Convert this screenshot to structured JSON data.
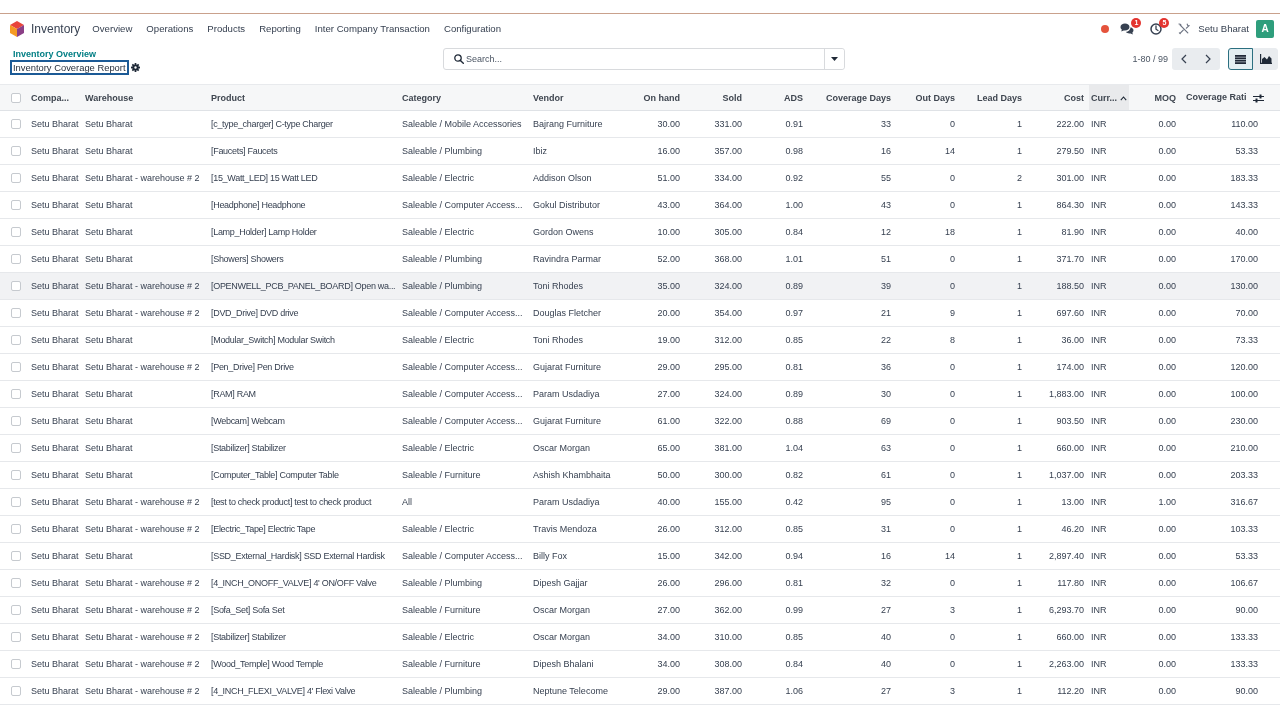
{
  "navbar": {
    "app_name": "Inventory",
    "menu": [
      "Overview",
      "Operations",
      "Products",
      "Reporting",
      "Inter Company Transaction",
      "Configuration"
    ],
    "notifications": [
      {
        "kind": "messages",
        "count": "1"
      },
      {
        "kind": "activities",
        "count": "5"
      }
    ],
    "user_name": "Setu Bharat",
    "avatar_letter": "A"
  },
  "breadcrumbs": [
    {
      "label": "Inventory Overview",
      "current": false,
      "focused": false
    },
    {
      "label": "Inventory Coverage Report",
      "current": true,
      "focused": true
    }
  ],
  "search": {
    "placeholder": "Search..."
  },
  "pager": {
    "value": "1-80 / 99"
  },
  "views": [
    {
      "kind": "list",
      "selected": true
    },
    {
      "kind": "graph",
      "selected": false
    }
  ],
  "table": {
    "select_all_checked": false,
    "columns": [
      {
        "label": "Compa...",
        "kind": "text",
        "sorted": false
      },
      {
        "label": "Warehouse",
        "kind": "text",
        "sorted": false
      },
      {
        "label": "Product",
        "kind": "text",
        "sorted": false
      },
      {
        "label": "Category",
        "kind": "text",
        "sorted": false
      },
      {
        "label": "Vendor",
        "kind": "text",
        "sorted": false
      },
      {
        "label": "On hand",
        "kind": "number",
        "sorted": false
      },
      {
        "label": "Sold",
        "kind": "number",
        "sorted": false
      },
      {
        "label": "ADS",
        "kind": "number",
        "sorted": false
      },
      {
        "label": "Coverage Days",
        "kind": "number",
        "sorted": false
      },
      {
        "label": "Out Days",
        "kind": "number",
        "sorted": false
      },
      {
        "label": "Lead Days",
        "kind": "number",
        "sorted": false
      },
      {
        "label": "Cost",
        "kind": "number",
        "sorted": false
      },
      {
        "label": "Curr...",
        "kind": "text",
        "sorted": true
      },
      {
        "label": "MOQ",
        "kind": "number",
        "sorted": false
      },
      {
        "label": "Coverage Rati",
        "kind": "number",
        "sorted": false
      }
    ],
    "rows": [
      {
        "checked": false,
        "highlighted": false,
        "cells": [
          "Setu Bharat",
          "Setu Bharat",
          "[c_type_charger] C-type Charger",
          "Saleable / Mobile Accessories",
          "Bajrang Furniture",
          "30.00",
          "331.00",
          "0.91",
          "33",
          "0",
          "1",
          "222.00",
          "INR",
          "0.00",
          "110.00"
        ]
      },
      {
        "checked": false,
        "highlighted": false,
        "cells": [
          "Setu Bharat",
          "Setu Bharat",
          "[Faucets] Faucets",
          "Saleable / Plumbing",
          "Ibiz",
          "16.00",
          "357.00",
          "0.98",
          "16",
          "14",
          "1",
          "279.50",
          "INR",
          "0.00",
          "53.33"
        ]
      },
      {
        "checked": false,
        "highlighted": false,
        "cells": [
          "Setu Bharat",
          "Setu Bharat - warehouse # 2",
          "[15_Watt_LED] 15 Watt LED",
          "Saleable / Electric",
          "Addison Olson",
          "51.00",
          "334.00",
          "0.92",
          "55",
          "0",
          "2",
          "301.00",
          "INR",
          "0.00",
          "183.33"
        ]
      },
      {
        "checked": false,
        "highlighted": false,
        "cells": [
          "Setu Bharat",
          "Setu Bharat",
          "[Headphone] Headphone",
          "Saleable / Computer Access...",
          "Gokul Distributor",
          "43.00",
          "364.00",
          "1.00",
          "43",
          "0",
          "1",
          "864.30",
          "INR",
          "0.00",
          "143.33"
        ]
      },
      {
        "checked": false,
        "highlighted": false,
        "cells": [
          "Setu Bharat",
          "Setu Bharat",
          "[Lamp_Holder] Lamp Holder",
          "Saleable / Electric",
          "Gordon Owens",
          "10.00",
          "305.00",
          "0.84",
          "12",
          "18",
          "1",
          "81.90",
          "INR",
          "0.00",
          "40.00"
        ]
      },
      {
        "checked": false,
        "highlighted": false,
        "cells": [
          "Setu Bharat",
          "Setu Bharat",
          "[Showers] Showers",
          "Saleable / Plumbing",
          "Ravindra Parmar",
          "52.00",
          "368.00",
          "1.01",
          "51",
          "0",
          "1",
          "371.70",
          "INR",
          "0.00",
          "170.00"
        ]
      },
      {
        "checked": false,
        "highlighted": true,
        "cells": [
          "Setu Bharat",
          "Setu Bharat - warehouse # 2",
          "[OPENWELL_PCB_PANEL_BOARD] Open wa...",
          "Saleable / Plumbing",
          "Toni Rhodes",
          "35.00",
          "324.00",
          "0.89",
          "39",
          "0",
          "1",
          "188.50",
          "INR",
          "0.00",
          "130.00"
        ]
      },
      {
        "checked": false,
        "highlighted": false,
        "cells": [
          "Setu Bharat",
          "Setu Bharat - warehouse # 2",
          "[DVD_Drive] DVD drive",
          "Saleable / Computer Access...",
          "Douglas Fletcher",
          "20.00",
          "354.00",
          "0.97",
          "21",
          "9",
          "1",
          "697.60",
          "INR",
          "0.00",
          "70.00"
        ]
      },
      {
        "checked": false,
        "highlighted": false,
        "cells": [
          "Setu Bharat",
          "Setu Bharat",
          "[Modular_Switch] Modular Switch",
          "Saleable / Electric",
          "Toni Rhodes",
          "19.00",
          "312.00",
          "0.85",
          "22",
          "8",
          "1",
          "36.00",
          "INR",
          "0.00",
          "73.33"
        ]
      },
      {
        "checked": false,
        "highlighted": false,
        "cells": [
          "Setu Bharat",
          "Setu Bharat - warehouse # 2",
          "[Pen_Drive] Pen Drive",
          "Saleable / Computer Access...",
          "Gujarat Furniture",
          "29.00",
          "295.00",
          "0.81",
          "36",
          "0",
          "1",
          "174.00",
          "INR",
          "0.00",
          "120.00"
        ]
      },
      {
        "checked": false,
        "highlighted": false,
        "cells": [
          "Setu Bharat",
          "Setu Bharat",
          "[RAM] RAM",
          "Saleable / Computer Access...",
          "Param Usdadiya",
          "27.00",
          "324.00",
          "0.89",
          "30",
          "0",
          "1",
          "1,883.00",
          "INR",
          "0.00",
          "100.00"
        ]
      },
      {
        "checked": false,
        "highlighted": false,
        "cells": [
          "Setu Bharat",
          "Setu Bharat",
          "[Webcam] Webcam",
          "Saleable / Computer Access...",
          "Gujarat Furniture",
          "61.00",
          "322.00",
          "0.88",
          "69",
          "0",
          "1",
          "903.50",
          "INR",
          "0.00",
          "230.00"
        ]
      },
      {
        "checked": false,
        "highlighted": false,
        "cells": [
          "Setu Bharat",
          "Setu Bharat",
          "[Stabilizer] Stabilizer",
          "Saleable / Electric",
          "Oscar Morgan",
          "65.00",
          "381.00",
          "1.04",
          "63",
          "0",
          "1",
          "660.00",
          "INR",
          "0.00",
          "210.00"
        ]
      },
      {
        "checked": false,
        "highlighted": false,
        "cells": [
          "Setu Bharat",
          "Setu Bharat",
          "[Computer_Table] Computer Table",
          "Saleable / Furniture",
          "Ashish Khambhaita",
          "50.00",
          "300.00",
          "0.82",
          "61",
          "0",
          "1",
          "1,037.00",
          "INR",
          "0.00",
          "203.33"
        ]
      },
      {
        "checked": false,
        "highlighted": false,
        "cells": [
          "Setu Bharat",
          "Setu Bharat - warehouse # 2",
          "[test to check product] test to check product",
          "All",
          "Param Usdadiya",
          "40.00",
          "155.00",
          "0.42",
          "95",
          "0",
          "1",
          "13.00",
          "INR",
          "1.00",
          "316.67"
        ]
      },
      {
        "checked": false,
        "highlighted": false,
        "cells": [
          "Setu Bharat",
          "Setu Bharat - warehouse # 2",
          "[Electric_Tape] Electric Tape",
          "Saleable / Electric",
          "Travis Mendoza",
          "26.00",
          "312.00",
          "0.85",
          "31",
          "0",
          "1",
          "46.20",
          "INR",
          "0.00",
          "103.33"
        ]
      },
      {
        "checked": false,
        "highlighted": false,
        "cells": [
          "Setu Bharat",
          "Setu Bharat",
          "[SSD_External_Hardisk] SSD External Hardisk",
          "Saleable / Computer Access...",
          "Billy Fox",
          "15.00",
          "342.00",
          "0.94",
          "16",
          "14",
          "1",
          "2,897.40",
          "INR",
          "0.00",
          "53.33"
        ]
      },
      {
        "checked": false,
        "highlighted": false,
        "cells": [
          "Setu Bharat",
          "Setu Bharat - warehouse # 2",
          "[4_INCH_ONOFF_VALVE] 4' ON/OFF Valve",
          "Saleable / Plumbing",
          "Dipesh Gajjar",
          "26.00",
          "296.00",
          "0.81",
          "32",
          "0",
          "1",
          "117.80",
          "INR",
          "0.00",
          "106.67"
        ]
      },
      {
        "checked": false,
        "highlighted": false,
        "cells": [
          "Setu Bharat",
          "Setu Bharat - warehouse # 2",
          "[Sofa_Set] Sofa Set",
          "Saleable / Furniture",
          "Oscar Morgan",
          "27.00",
          "362.00",
          "0.99",
          "27",
          "3",
          "1",
          "6,293.70",
          "INR",
          "0.00",
          "90.00"
        ]
      },
      {
        "checked": false,
        "highlighted": false,
        "cells": [
          "Setu Bharat",
          "Setu Bharat - warehouse # 2",
          "[Stabilizer] Stabilizer",
          "Saleable / Electric",
          "Oscar Morgan",
          "34.00",
          "310.00",
          "0.85",
          "40",
          "0",
          "1",
          "660.00",
          "INR",
          "0.00",
          "133.33"
        ]
      },
      {
        "checked": false,
        "highlighted": false,
        "cells": [
          "Setu Bharat",
          "Setu Bharat - warehouse # 2",
          "[Wood_Temple] Wood Temple",
          "Saleable / Furniture",
          "Dipesh Bhalani",
          "34.00",
          "308.00",
          "0.84",
          "40",
          "0",
          "1",
          "2,263.00",
          "INR",
          "0.00",
          "133.33"
        ]
      },
      {
        "checked": false,
        "highlighted": false,
        "cells": [
          "Setu Bharat",
          "Setu Bharat - warehouse # 2",
          "[4_INCH_FLEXI_VALVE] 4' Flexi Valve",
          "Saleable / Plumbing",
          "Neptune Telecome",
          "29.00",
          "387.00",
          "1.06",
          "27",
          "3",
          "1",
          "112.20",
          "INR",
          "0.00",
          "90.00"
        ]
      }
    ]
  }
}
